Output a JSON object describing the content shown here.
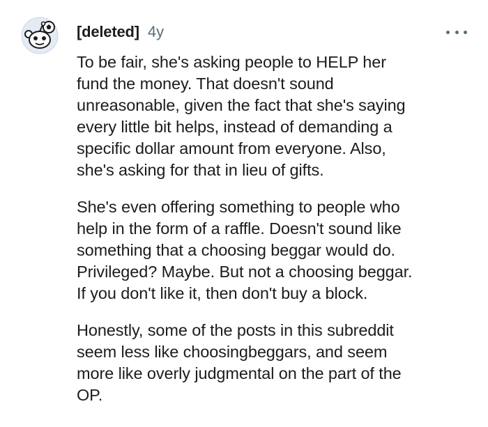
{
  "comment": {
    "author": "[deleted]",
    "age": "4y",
    "more_label": "•••",
    "paragraphs": [
      [
        "To be fair, she's asking people to HELP her",
        "fund the money. That doesn't sound",
        "unreasonable, given the fact that she's saying",
        "every little bit helps, instead of demanding a",
        "specific dollar amount from everyone. Also,",
        "she's asking for that in lieu of gifts."
      ],
      [
        "She's even offering something to people who",
        "help in the form of a raffle. Doesn't sound like",
        "something that a choosing beggar would do.",
        "Privileged? Maybe. But not a choosing beggar.",
        "If you don't like it, then don't buy a block."
      ],
      [
        "Honestly, some of the posts in this subreddit",
        "seem less like choosingbeggars, and seem",
        "more like overly judgmental on the part of the",
        "OP."
      ]
    ]
  },
  "colors": {
    "avatar_bg": "#e4ebf5",
    "avatar_ring": "#c9d6ea",
    "text": "#1c1c1c",
    "meta": "#576f76"
  },
  "icons": {
    "avatar": "snoo-avatar-icon",
    "more": "more-options-icon"
  }
}
